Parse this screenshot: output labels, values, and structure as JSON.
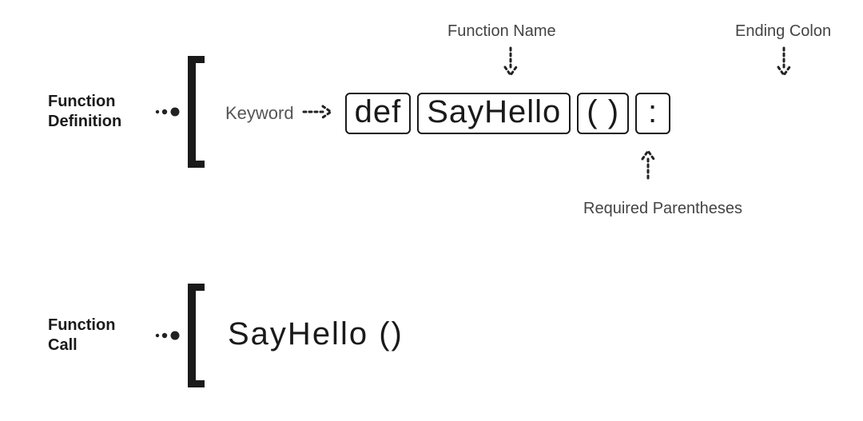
{
  "definition": {
    "label_line1": "Function",
    "label_line2": "Definition",
    "keyword_label": "Keyword",
    "token_def": "def",
    "token_name": "SayHello",
    "token_parens": "( )",
    "token_colon": ":"
  },
  "call": {
    "label_line1": "Function",
    "label_line2": "Call",
    "code": "SayHello ()"
  },
  "annotations": {
    "function_name": "Function Name",
    "ending_colon": "Ending Colon",
    "required_parens": "Required Parentheses"
  }
}
